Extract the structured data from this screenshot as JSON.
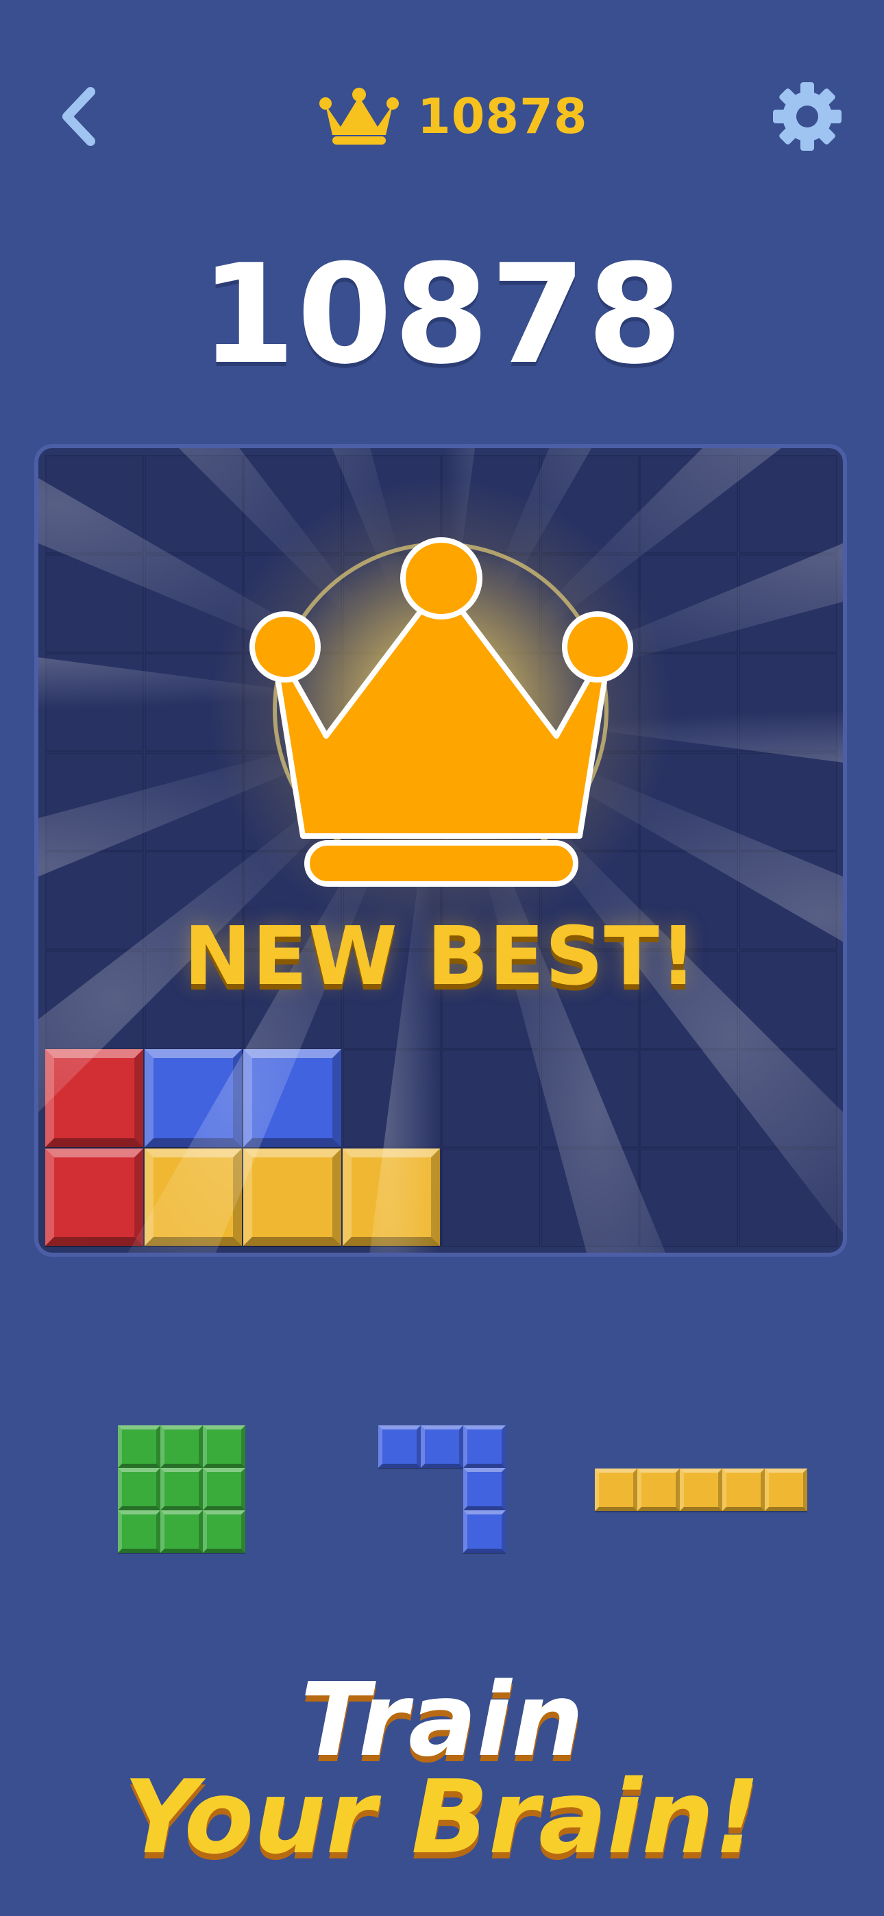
{
  "header": {
    "back_icon": "chevron-left-icon",
    "best_icon": "crown-icon",
    "best_score": "10878",
    "settings_icon": "gear-icon"
  },
  "score": "10878",
  "board": {
    "rows": 8,
    "cols": 8,
    "celebration_icon": "crown-icon",
    "banner": "NEW BEST!",
    "placed_blocks": [
      {
        "row": 6,
        "col": 0,
        "color": "red"
      },
      {
        "row": 6,
        "col": 1,
        "color": "blue"
      },
      {
        "row": 6,
        "col": 2,
        "color": "blue"
      },
      {
        "row": 7,
        "col": 0,
        "color": "red"
      },
      {
        "row": 7,
        "col": 1,
        "color": "yellow"
      },
      {
        "row": 7,
        "col": 2,
        "color": "yellow"
      },
      {
        "row": 7,
        "col": 3,
        "color": "yellow"
      }
    ]
  },
  "pieces": [
    {
      "name": "green-square-3x3",
      "color": "green",
      "cells": [
        [
          0,
          0
        ],
        [
          0,
          1
        ],
        [
          0,
          2
        ],
        [
          1,
          0
        ],
        [
          1,
          1
        ],
        [
          1,
          2
        ],
        [
          2,
          0
        ],
        [
          2,
          1
        ],
        [
          2,
          2
        ]
      ]
    },
    {
      "name": "blue-corner",
      "color": "blue",
      "cells": [
        [
          0,
          0
        ],
        [
          0,
          1
        ],
        [
          0,
          2
        ],
        [
          1,
          2
        ],
        [
          2,
          2
        ]
      ]
    },
    {
      "name": "yellow-line-5",
      "color": "yellow",
      "cells": [
        [
          0,
          0
        ],
        [
          0,
          1
        ],
        [
          0,
          2
        ],
        [
          0,
          3
        ],
        [
          0,
          4
        ]
      ]
    }
  ],
  "slogan": {
    "line1": "Train",
    "line2": "Your Brain!"
  },
  "colors": {
    "background": "#3a4f8f",
    "board": "#2a3567",
    "red": "#d22f35",
    "blue": "#4263e0",
    "yellow": "#f0b832",
    "green": "#3aac3c",
    "gold": "#f7c21d"
  }
}
